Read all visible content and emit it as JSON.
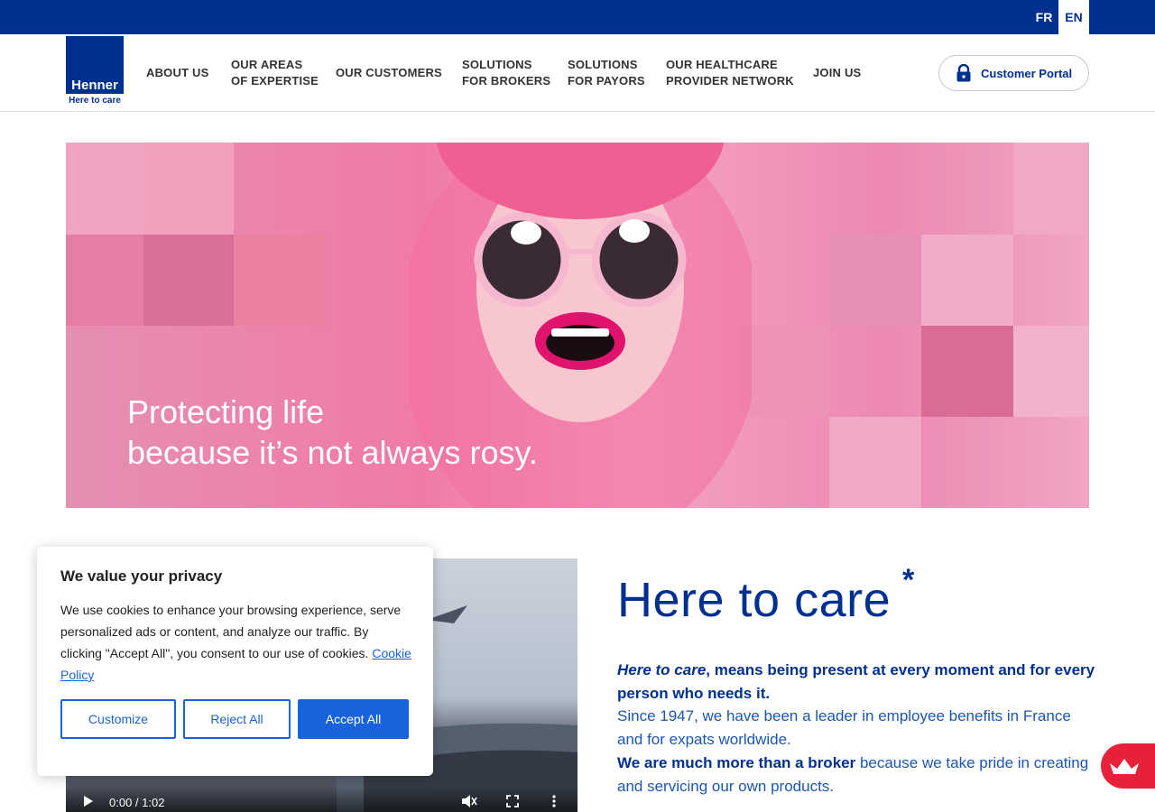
{
  "lang": {
    "fr": "FR",
    "en": "EN"
  },
  "logo": {
    "name": "Henner",
    "tagline": "Here to care"
  },
  "nav": [
    {
      "l1": "ABOUT US",
      "l2": ""
    },
    {
      "l1": "OUR AREAS",
      "l2": "OF EXPERTISE"
    },
    {
      "l1": "OUR CUSTOMERS",
      "l2": ""
    },
    {
      "l1": "SOLUTIONS",
      "l2": "FOR BROKERS"
    },
    {
      "l1": "SOLUTIONS",
      "l2": "FOR PAYORS"
    },
    {
      "l1": "OUR HEALTHCARE",
      "l2": "PROVIDER NETWORK"
    },
    {
      "l1": "JOIN US",
      "l2": ""
    }
  ],
  "portal": {
    "label": "Customer Portal",
    "icon": "lock-icon"
  },
  "hero": {
    "line1": "Protecting life",
    "line2": "because it’s not always rosy."
  },
  "video": {
    "time": "0:00 / 1:02"
  },
  "care": {
    "title": "Here to care",
    "asterisk": "*",
    "p1_italic": "Here to care",
    "p1_rest": ", means being present at every moment and for every person who needs it.",
    "p2": "Since 1947, we have been a leader in employee benefits in France and for expats worldwide.",
    "p3_bold": "We are much more than a broker",
    "p3_rest": " because we take pride in creating and servicing our own products."
  },
  "cookie": {
    "title": "We value your privacy",
    "body": "We use cookies to enhance your browsing experience, serve personalized ads or content, and analyze our traffic. By clicking \"Accept All\", you consent to our use of cookies. ",
    "link": "Cookie Policy",
    "customize": "Customize",
    "reject": "Reject All",
    "accept": "Accept All"
  },
  "colors": {
    "brand": "#00308f",
    "accent": "#1863dc",
    "float": "#e8213b"
  }
}
